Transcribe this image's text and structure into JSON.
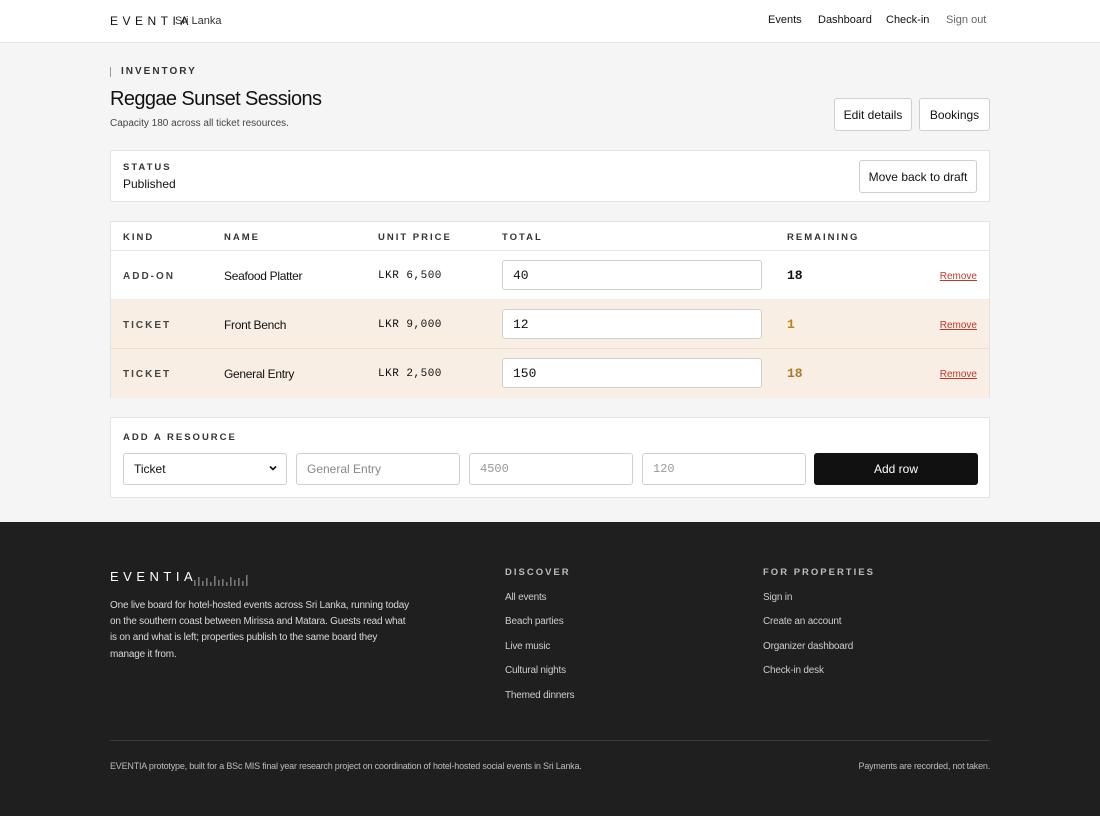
{
  "header": {
    "brand": "EVENTIA",
    "location": "Sri Lanka",
    "nav": [
      "Events",
      "Dashboard",
      "Check-in"
    ],
    "sign_out": "Sign out"
  },
  "page": {
    "section_label": "INVENTORY",
    "title": "Reggae Sunset Sessions",
    "subtitle": "Capacity 180 across all ticket resources.",
    "edit_button": "Edit details",
    "bookings_button": "Bookings"
  },
  "status": {
    "label": "STATUS",
    "value": "Published",
    "action": "Move back to draft"
  },
  "table": {
    "headers": {
      "kind": "KIND",
      "name": "NAME",
      "unit_price": "UNIT PRICE",
      "total": "TOTAL",
      "remaining": "REMAINING"
    },
    "rows": [
      {
        "kind": "ADD-ON",
        "name": "Seafood Platter",
        "price": "LKR 6,500",
        "total": "40",
        "remaining": "18",
        "remove": "Remove",
        "remaining_color": "#111111"
      },
      {
        "kind": "TICKET",
        "name": "Front Bench",
        "price": "LKR 9,000",
        "total": "12",
        "remaining": "1",
        "remove": "Remove",
        "remaining_color": "#b8860b"
      },
      {
        "kind": "TICKET",
        "name": "General Entry",
        "price": "LKR 2,500",
        "total": "150",
        "remaining": "18",
        "remove": "Remove",
        "remaining_color": "#b07a2a"
      }
    ]
  },
  "add_resource": {
    "label": "ADD A RESOURCE",
    "kind_selected": "Ticket",
    "name_placeholder": "General Entry",
    "price_placeholder": "4500",
    "total_placeholder": "120",
    "button": "Add row"
  },
  "footer": {
    "brand": "EVENTIA",
    "about": "One live board for hotel-hosted events across Sri Lanka, running today on the southern coast between Mirissa and Matara. Guests read what is on and what is left; properties publish to the same board they manage it from.",
    "discover_title": "DISCOVER",
    "discover_links": [
      "All events",
      "Beach parties",
      "Live music",
      "Cultural nights",
      "Themed dinners"
    ],
    "properties_title": "FOR PROPERTIES",
    "properties_links": [
      "Sign in",
      "Create an account",
      "Organizer dashboard",
      "Check-in desk"
    ],
    "legal_left": "EVENTIA prototype, built for a BSc MIS final year research project on coordination of hotel-hosted social events in Sri Lanka.",
    "legal_right": "Payments are recorded, not taken."
  },
  "colors": {
    "accent_remove": "#c0392b",
    "row_tint": "#f8eee3",
    "footer_bg": "#1f1f1f"
  }
}
